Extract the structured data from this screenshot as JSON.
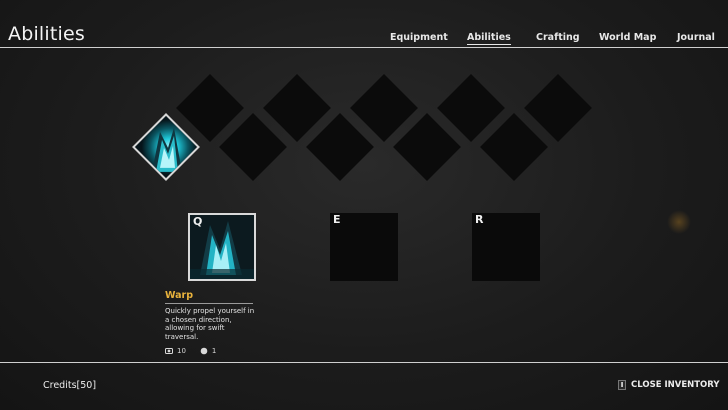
{
  "header": {
    "title": "Abilities",
    "tabs": [
      {
        "label": "Equipment",
        "active": false
      },
      {
        "label": "Abilities",
        "active": true
      },
      {
        "label": "Crafting",
        "active": false
      },
      {
        "label": "World Map",
        "active": false
      },
      {
        "label": "Journal",
        "active": false
      }
    ]
  },
  "ability_grid": {
    "slots": [
      {
        "id": "warp",
        "unlocked": true,
        "icon": "warp-crystal-icon"
      },
      {
        "id": "empty-1",
        "unlocked": false
      },
      {
        "id": "empty-2",
        "unlocked": false
      },
      {
        "id": "empty-3",
        "unlocked": false
      },
      {
        "id": "empty-4",
        "unlocked": false
      },
      {
        "id": "empty-5",
        "unlocked": false
      },
      {
        "id": "empty-6",
        "unlocked": false
      },
      {
        "id": "empty-7",
        "unlocked": false
      },
      {
        "id": "empty-8",
        "unlocked": false
      },
      {
        "id": "empty-9",
        "unlocked": false
      }
    ]
  },
  "hotkeys": [
    {
      "key": "Q",
      "equipped": true,
      "icon": "warp-crystal-icon"
    },
    {
      "key": "E",
      "equipped": false
    },
    {
      "key": "R",
      "equipped": false
    }
  ],
  "selected_ability": {
    "name": "Warp",
    "description": "Quickly propel yourself in a chosen direction, allowing for swift traversal.",
    "stats": [
      {
        "icon": "cooldown-icon",
        "value": "10"
      },
      {
        "icon": "charge-icon",
        "value": "1"
      }
    ]
  },
  "footer": {
    "credits_label": "Credits[50]",
    "close_key": "I",
    "close_label": "CLOSE INVENTORY"
  },
  "colors": {
    "accent": "#e8b23c",
    "crystal": "#1fc7d8",
    "rule": "#cfcfcf"
  }
}
